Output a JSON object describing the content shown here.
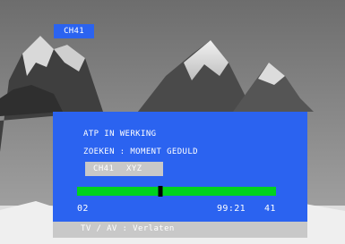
{
  "channel_badge": "CH41",
  "osd": {
    "status_line": "ATP IN WERKING",
    "search_line": "ZOEKEN : MOMENT GEDULD",
    "current_channel": {
      "number": "CH41",
      "name": "XYZ"
    },
    "progress": {
      "fraction": 0.42,
      "start_label": "02",
      "time_label": "99:21",
      "count_label": "41"
    },
    "footer_hint": "TV / AV : Verlaten"
  },
  "colors": {
    "osd_blue": "#2b63f0",
    "progress_green": "#00d21e",
    "panel_gray": "#c8c8c8"
  }
}
